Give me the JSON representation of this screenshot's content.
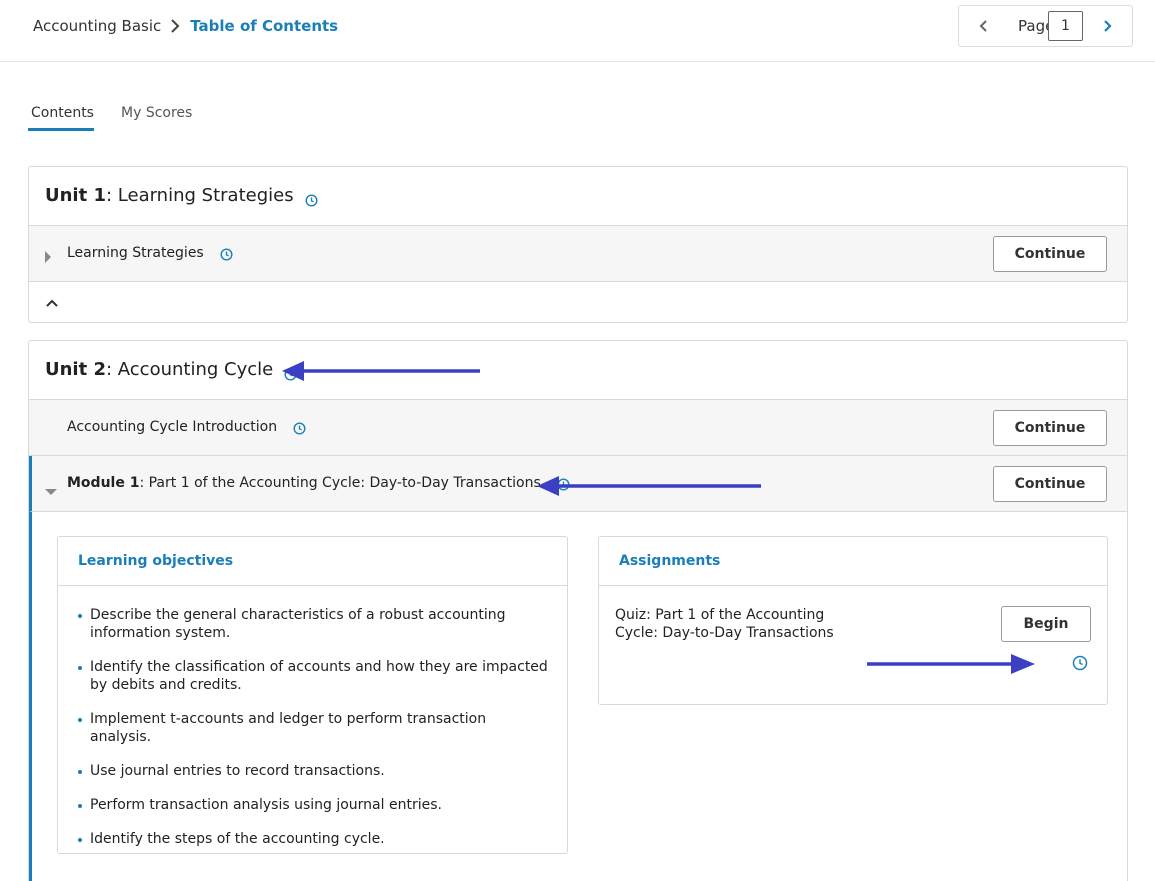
{
  "breadcrumb": {
    "root": "Accounting Basic",
    "current": "Table of Contents"
  },
  "pager": {
    "label": "Page",
    "value": "1"
  },
  "tabs": {
    "contents": "Contents",
    "scores": "My Scores"
  },
  "unit1": {
    "number": "Unit 1",
    "title": ": Learning Strategies",
    "rows": [
      {
        "label": "Learning Strategies",
        "button": "Continue"
      }
    ]
  },
  "unit2": {
    "number": "Unit 2",
    "title": ": Accounting Cycle",
    "intro": {
      "label": "Accounting Cycle Introduction",
      "button": "Continue"
    },
    "module": {
      "number": "Module 1",
      "title": ": Part 1 of the Accounting Cycle: Day-to-Day Transactions",
      "button": "Continue"
    },
    "objectives": {
      "title": "Learning objectives",
      "items": [
        "Describe the general characteristics of a robust accounting information system.",
        "Identify the classification of accounts and how they are impacted by debits and credits.",
        "Implement t-accounts and ledger to perform transaction analysis.",
        "Use journal entries to record transactions.",
        "Perform transaction analysis using journal entries.",
        "Identify the steps of the accounting cycle."
      ]
    },
    "assignments": {
      "title": "Assignments",
      "quiz": "Quiz: Part 1 of the Accounting Cycle: Day-to-Day Transactions",
      "button": "Begin"
    }
  },
  "colors": {
    "accent": "#1a7fb8",
    "annotation_arrow": "#3b3fc4"
  },
  "icons": [
    "chevron-right-icon",
    "chevron-left-icon",
    "clock-icon",
    "caret-right-icon",
    "caret-down-icon",
    "chevron-up-icon",
    "arrow-left-icon",
    "arrow-right-icon"
  ]
}
